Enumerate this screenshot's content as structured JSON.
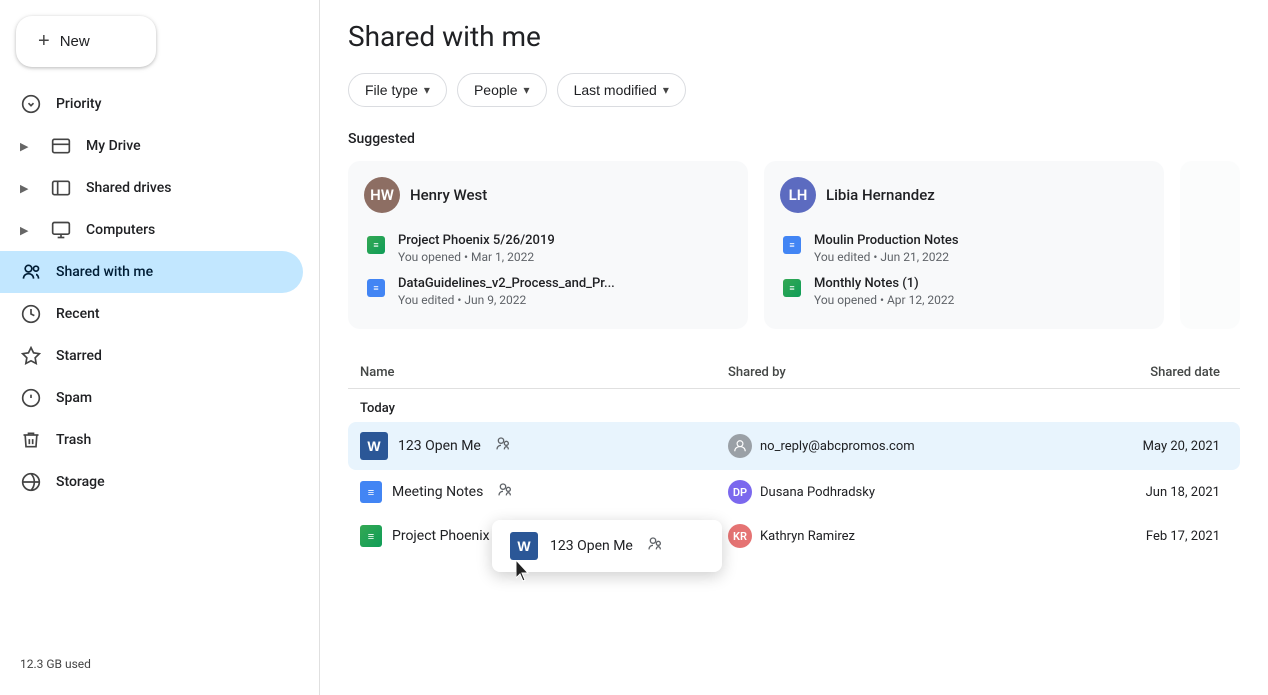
{
  "sidebar": {
    "new_button": "New",
    "items": [
      {
        "id": "priority",
        "label": "Priority",
        "icon": "☑",
        "arrow": false
      },
      {
        "id": "my-drive",
        "label": "My Drive",
        "icon": "🗂",
        "arrow": true
      },
      {
        "id": "shared-drives",
        "label": "Shared drives",
        "icon": "⊞",
        "arrow": true
      },
      {
        "id": "computers",
        "label": "Computers",
        "icon": "💻",
        "arrow": true
      },
      {
        "id": "shared-with-me",
        "label": "Shared with me",
        "icon": "👤",
        "active": true
      },
      {
        "id": "recent",
        "label": "Recent",
        "icon": "🕐"
      },
      {
        "id": "starred",
        "label": "Starred",
        "icon": "☆"
      },
      {
        "id": "spam",
        "label": "Spam",
        "icon": "ℹ"
      },
      {
        "id": "trash",
        "label": "Trash",
        "icon": "🗑"
      },
      {
        "id": "storage",
        "label": "Storage",
        "icon": "☁"
      }
    ],
    "storage_used": "12.3 GB used"
  },
  "main": {
    "title": "Shared with me",
    "filters": [
      {
        "id": "file-type",
        "label": "File type"
      },
      {
        "id": "people",
        "label": "People"
      },
      {
        "id": "last-modified",
        "label": "Last modified"
      }
    ],
    "suggested_label": "Suggested",
    "suggestion_cards": [
      {
        "user": "Henry West",
        "avatar_initials": "HW",
        "avatar_class": "avatar-henry",
        "files": [
          {
            "type": "sheets",
            "name": "Project Phoenix 5/26/2019",
            "meta": "You opened • Mar 1, 2022"
          },
          {
            "type": "docs",
            "name": "DataGuidelines_v2_Process_and_Pr...",
            "meta": "You edited • Jun 9, 2022"
          }
        ]
      },
      {
        "user": "Libia Hernandez",
        "avatar_initials": "LH",
        "avatar_class": "avatar-libia",
        "files": [
          {
            "type": "docs",
            "name": "Moulin Production Notes",
            "meta": "You edited • Jun 21, 2022"
          },
          {
            "type": "sheets",
            "name": "Monthly Notes (1)",
            "meta": "You opened • Apr 12, 2022"
          }
        ]
      }
    ],
    "file_list": {
      "columns": [
        "Name",
        "Shared by",
        "Shared date"
      ],
      "sections": [
        {
          "label": "Today",
          "files": [
            {
              "id": "123-open-me",
              "type": "word",
              "name": "123 Open Me",
              "shared": true,
              "shared_by": "no_reply@abcpromos.com",
              "shared_by_type": "generic",
              "date": "May 20, 2021",
              "highlighted": true
            },
            {
              "id": "meeting-notes",
              "type": "docs",
              "name": "Meeting Notes",
              "shared": true,
              "shared_by": "Dusana Podhradsky",
              "shared_by_type": "dusana",
              "date": "Jun 18, 2021"
            },
            {
              "id": "project-phoenix",
              "type": "sheets",
              "name": "Project Phoenix",
              "shared": true,
              "shared_by": "Kathryn Ramirez",
              "shared_by_type": "kathryn",
              "date": "Feb 17, 2021"
            }
          ]
        }
      ]
    }
  },
  "popup": {
    "file_type": "word",
    "file_name": "123 Open Me",
    "shared": true
  }
}
